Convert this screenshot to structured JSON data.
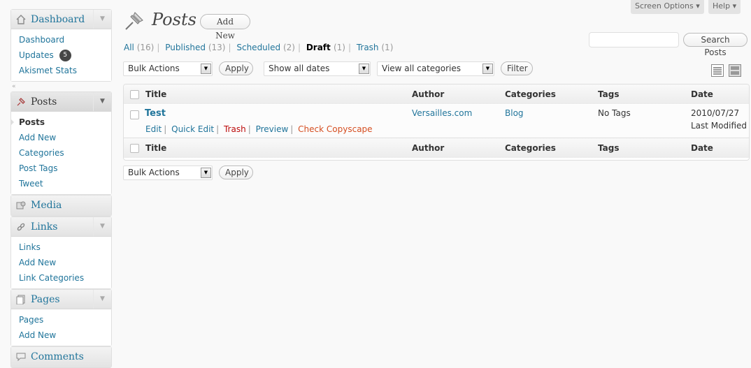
{
  "sidebar": {
    "dashboard": {
      "label": "Dashboard",
      "items": [
        "Dashboard",
        "Updates",
        "Akismet Stats"
      ],
      "updates_count": "5"
    },
    "posts": {
      "label": "Posts",
      "items": [
        "Posts",
        "Add New",
        "Categories",
        "Post Tags",
        "Tweet"
      ]
    },
    "media": {
      "label": "Media"
    },
    "links": {
      "label": "Links",
      "items": [
        "Links",
        "Add New",
        "Link Categories"
      ]
    },
    "pages": {
      "label": "Pages",
      "items": [
        "Pages",
        "Add New"
      ]
    },
    "comments": {
      "label": "Comments"
    }
  },
  "top": {
    "screen_options": "Screen Options",
    "help": "Help",
    "search_button": "Search Posts",
    "search_value": ""
  },
  "header": {
    "title": "Posts",
    "add_new": "Add New"
  },
  "filters": [
    {
      "label": "All",
      "count": "(16)"
    },
    {
      "label": "Published",
      "count": "(13)"
    },
    {
      "label": "Scheduled",
      "count": "(2)"
    },
    {
      "label": "Draft",
      "count": "(1)"
    },
    {
      "label": "Trash",
      "count": "(1)"
    }
  ],
  "tablenav": {
    "bulk_actions": "Bulk Actions",
    "apply": "Apply",
    "dates": "Show all dates",
    "categories": "View all categories",
    "filter": "Filter"
  },
  "table": {
    "columns": [
      "Title",
      "Author",
      "Categories",
      "Tags",
      "Date"
    ],
    "rows": [
      {
        "title": "Test",
        "author": "Versailles.com",
        "category": "Blog",
        "tags": "No Tags",
        "date": "2010/07/27",
        "date_status": "Last Modified",
        "actions": [
          "Edit",
          "Quick Edit",
          "Trash",
          "Preview",
          "Check Copyscape"
        ]
      }
    ]
  },
  "colors": {
    "link": "#21759b",
    "trash": "#bc0b0b",
    "copyscape": "#d54e21"
  }
}
